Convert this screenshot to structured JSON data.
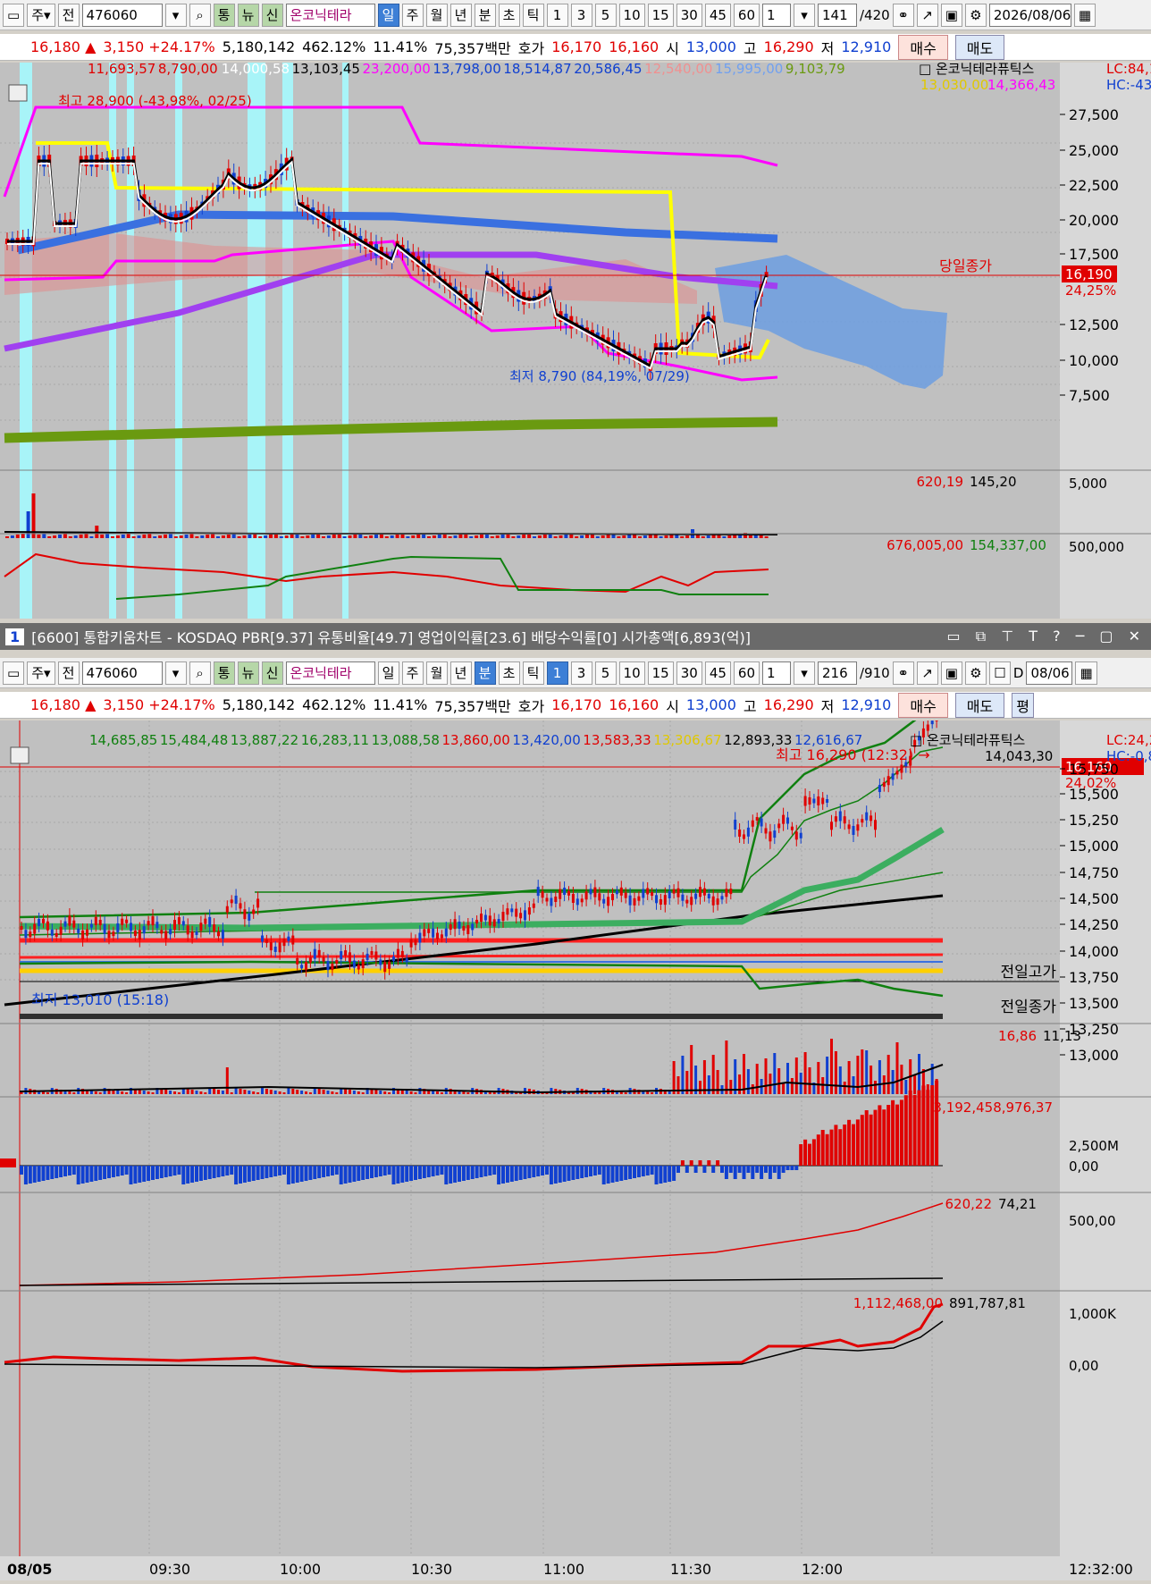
{
  "top": {
    "toolbar": {
      "market": "주",
      "prev": "전",
      "code": "476060",
      "tong": "통",
      "nyu": "뉴",
      "sin": "신",
      "stock_name": "온코닉테라",
      "periods": [
        "일",
        "주",
        "월",
        "년",
        "분",
        "초",
        "틱"
      ],
      "nums": [
        "1",
        "3",
        "5",
        "10",
        "15",
        "30",
        "45",
        "60"
      ],
      "count_val": "1",
      "page": "141",
      "page_total": "/420",
      "date": "2026/08/06"
    },
    "quote": {
      "price": "16,180 ▲",
      "change": "3,150 +24.17%",
      "volume": "5,180,142",
      "vol_rate": "462.12%",
      "turnover": "11.41%",
      "amount": "75,357백만",
      "hoga_label": "호가",
      "ask": "16,170",
      "bid": "16,160",
      "open_label": "시",
      "open": "13,000",
      "high_label": "고",
      "high": "16,290",
      "low_label": "저",
      "low": "12,910",
      "buy": "매수",
      "sell": "매도"
    },
    "legend1": [
      "11,693,57",
      "8,790,00",
      "14,000,58",
      "13,103,45",
      "23,200,00",
      "13,798,00",
      "18,514,87",
      "20,586,45",
      "12,540,00",
      "15,995,00",
      "9,103,79"
    ],
    "legend_name": "□ 온코닉테라퓨틱스",
    "lc": "LC:84,19",
    "hc": "HC:-43,98",
    "legend2": [
      "13,030,00",
      "14,366,43"
    ],
    "high_note": "최고 28,900 (-43,98%, 02/25)",
    "low_note": "최저 8,790 (84,19%, 07/29)",
    "close_label": "당일종가",
    "close_price": "16,190",
    "close_pct": "24,25%",
    "yticks": [
      "27,500",
      "25,000",
      "22,500",
      "20,000",
      "17,500",
      "12,500",
      "10,000",
      "7,500"
    ],
    "vol_legend": [
      "620,19",
      "145,20"
    ],
    "vol_tick": "5,000",
    "ind_legend": [
      "676,005,00",
      "154,337,00"
    ],
    "ind_tick": "500,000"
  },
  "title_bar": {
    "num": "1",
    "text": "[6600] 통합키움차트 - KOSDAQ PBR[9.37] 유통비율[49.7] 영업이익률[23.6] 배당수익률[0] 시가총액[6,893(억)]"
  },
  "bottom": {
    "toolbar": {
      "market": "주",
      "prev": "전",
      "code": "476060",
      "tong": "통",
      "nyu": "뉴",
      "sin": "신",
      "stock_name": "온코닉테라",
      "periods": [
        "일",
        "주",
        "월",
        "년",
        "분",
        "초",
        "틱"
      ],
      "nums": [
        "1",
        "3",
        "5",
        "10",
        "15",
        "30",
        "45",
        "60"
      ],
      "count_val": "1",
      "page": "216",
      "page_total": "/910",
      "d_label": "D",
      "date": "08/06"
    },
    "quote": {
      "price": "16,180 ▲",
      "change": "3,150 +24.17%",
      "volume": "5,180,142",
      "vol_rate": "462.12%",
      "turnover": "11.41%",
      "amount": "75,357백만",
      "hoga_label": "호가",
      "ask": "16,170",
      "bid": "16,160",
      "open_label": "시",
      "open": "13,000",
      "high_label": "고",
      "high": "16,290",
      "low_label": "저",
      "low": "12,910",
      "buy": "매수",
      "sell": "매도",
      "pyeong": "평"
    },
    "legend1": [
      "14,685,85",
      "15,484,48",
      "13,887,22",
      "16,283,11",
      "13,088,58",
      "13,860,00",
      "13,420,00",
      "13,583,33",
      "13,306,67",
      "12,893,33",
      "12,616,67"
    ],
    "legend_name": "□ 온코닉테라퓨틱스",
    "lc": "LC:24,21",
    "hc": "HC:-0,80",
    "high_note": "최고 16,290 (12:32) →",
    "extra_val": "14,043,30",
    "close_price": "16,160",
    "close_pct": "24,02%",
    "low_note": "최저 13,010 (15:18)",
    "prev_high_label": "전일고가",
    "prev_close_label": "전일종가",
    "yticks": [
      "15,750",
      "15,500",
      "15,250",
      "15,000",
      "14,750",
      "14,500",
      "14,250",
      "14,000",
      "13,750",
      "13,500",
      "13,250",
      "13,000"
    ],
    "vol_legend": [
      "16,86",
      "11,13"
    ],
    "money_legend": "3,192,458,976,37",
    "money_ticks": [
      "2,500M",
      "0,00"
    ],
    "obv_legend": [
      "620,22",
      "74,21"
    ],
    "obv_tick": "500,00",
    "last_legend": [
      "1,112,468,00",
      "891,787,81"
    ],
    "last_ticks": [
      "1,000K",
      "0,00"
    ],
    "xlabels": [
      "08/05",
      "09:30",
      "10:00",
      "10:30",
      "11:00",
      "11:30",
      "12:00",
      "12:32:00"
    ]
  },
  "colors": {
    "up": "#e00000",
    "down": "#1040d0",
    "magenta": "#ff00ff",
    "yellow": "#ffff00",
    "purple": "#a040f0",
    "olive": "#6a9a10",
    "green": "#108010",
    "cyan": "#a8f4f8"
  }
}
